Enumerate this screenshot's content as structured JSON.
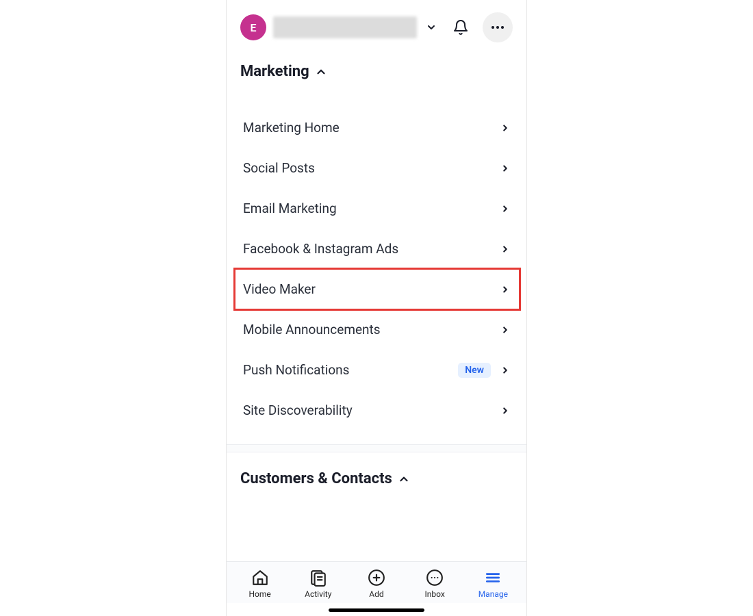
{
  "header": {
    "avatar_initial": "E"
  },
  "sections": {
    "marketing": {
      "title": "Marketing",
      "items": [
        {
          "label": "Marketing Home"
        },
        {
          "label": "Social Posts"
        },
        {
          "label": "Email Marketing"
        },
        {
          "label": "Facebook & Instagram Ads"
        },
        {
          "label": "Video Maker"
        },
        {
          "label": "Mobile Announcements"
        },
        {
          "label": "Push Notifications",
          "badge": "New"
        },
        {
          "label": "Site Discoverability"
        }
      ]
    },
    "customers": {
      "title": "Customers & Contacts"
    }
  },
  "nav": {
    "home": {
      "label": "Home"
    },
    "activity": {
      "label": "Activity"
    },
    "add": {
      "label": "Add"
    },
    "inbox": {
      "label": "Inbox"
    },
    "manage": {
      "label": "Manage"
    }
  },
  "highlighted_item_index": 4
}
